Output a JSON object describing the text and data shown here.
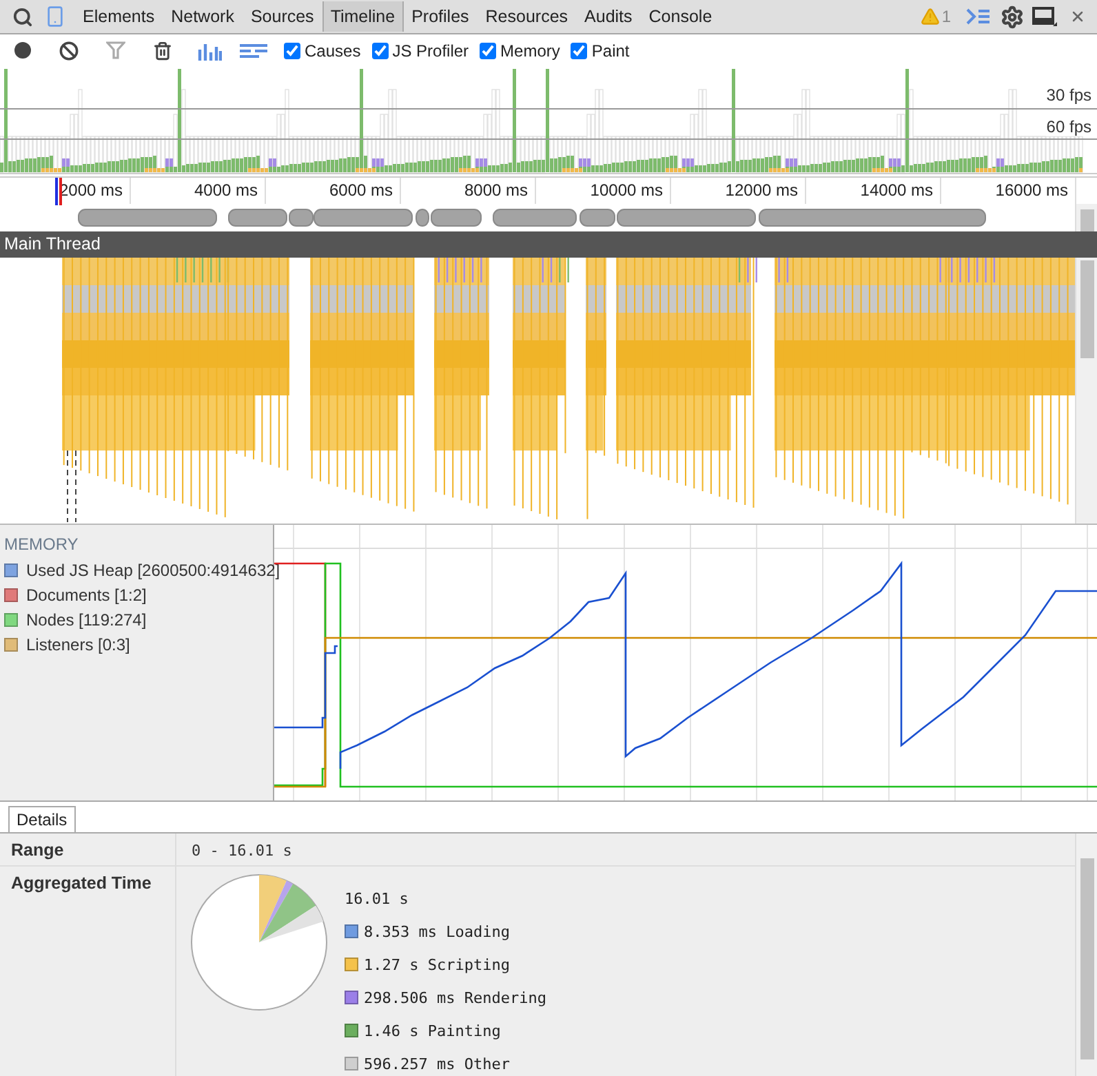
{
  "toolbar": {
    "tabs": [
      {
        "label": "Elements",
        "selected": false
      },
      {
        "label": "Network",
        "selected": false
      },
      {
        "label": "Sources",
        "selected": false
      },
      {
        "label": "Timeline",
        "selected": true
      },
      {
        "label": "Profiles",
        "selected": false
      },
      {
        "label": "Resources",
        "selected": false
      },
      {
        "label": "Audits",
        "selected": false
      },
      {
        "label": "Console",
        "selected": false
      }
    ],
    "warning_count": "1"
  },
  "controls": {
    "checkboxes": [
      {
        "label": "Causes",
        "checked": true
      },
      {
        "label": "JS Profiler",
        "checked": true
      },
      {
        "label": "Memory",
        "checked": true
      },
      {
        "label": "Paint",
        "checked": true
      }
    ]
  },
  "overview": {
    "fps_labels": [
      "30 fps",
      "60 fps"
    ],
    "ruler_ticks": [
      "2000 ms",
      "4000 ms",
      "6000 ms",
      "8000 ms",
      "10000 ms",
      "12000 ms",
      "14000 ms",
      "16000 ms"
    ]
  },
  "main_thread": {
    "title": "Main Thread"
  },
  "memory": {
    "title": "MEMORY",
    "legend": [
      {
        "label": "Used JS Heap [2600500:4914632]",
        "color": "#7ea3e0"
      },
      {
        "label": "Documents [1:2]",
        "color": "#e07a7a"
      },
      {
        "label": "Nodes [119:274]",
        "color": "#80d880"
      },
      {
        "label": "Listeners [0:3]",
        "color": "#e0bb78"
      }
    ]
  },
  "details": {
    "tabs": [
      {
        "label": "Details",
        "selected": true
      }
    ],
    "range": {
      "label": "Range",
      "value": "0 - 16.01 s"
    },
    "aggregated": {
      "label": "Aggregated Time",
      "total": "16.01 s",
      "legend": [
        {
          "label": "8.353 ms Loading",
          "color": "#6f9be0"
        },
        {
          "label": "1.27 s Scripting",
          "color": "#f5c24a"
        },
        {
          "label": "298.506 ms Rendering",
          "color": "#9b7fe8"
        },
        {
          "label": "1.46 s Painting",
          "color": "#6bae5e"
        },
        {
          "label": "596.257 ms Other",
          "color": "#cfcfcf"
        }
      ]
    }
  }
}
